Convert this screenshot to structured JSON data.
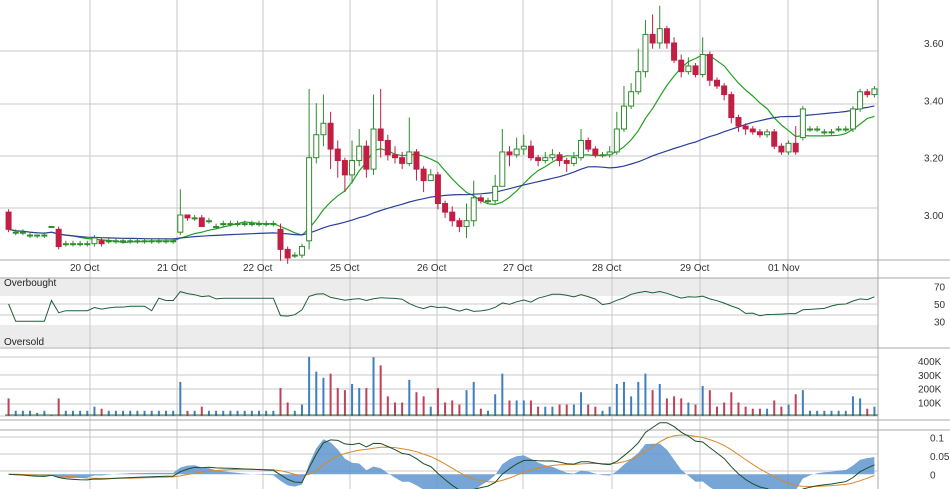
{
  "chart_data": [
    {
      "type": "candlestick",
      "panel": "price",
      "x_labels": [
        "20 Oct",
        "21 Oct",
        "22 Oct",
        "25 Oct",
        "26 Oct",
        "27 Oct",
        "28 Oct",
        "29 Oct",
        "01 Nov"
      ],
      "y_ticks": [
        "3.60",
        "3.40",
        "3.20",
        "3.00"
      ],
      "ylim": [
        2.85,
        3.75
      ],
      "grid": true,
      "overlays": [
        {
          "kind": "short-moving-average",
          "color": "#22a022"
        },
        {
          "kind": "long-moving-average",
          "color": "#2a3f9a"
        }
      ],
      "candles": [
        [
          3.01,
          2.95,
          3.02,
          2.94
        ],
        [
          2.94,
          2.94,
          2.95,
          2.93
        ],
        [
          2.94,
          2.94,
          2.95,
          2.93
        ],
        [
          2.93,
          2.93,
          2.94,
          2.92
        ],
        [
          2.93,
          2.93,
          2.93,
          2.92
        ],
        [
          2.93,
          2.93,
          2.94,
          2.92
        ],
        [
          2.96,
          2.96,
          2.96,
          2.96
        ],
        [
          2.95,
          2.89,
          2.96,
          2.88
        ],
        [
          2.9,
          2.9,
          2.91,
          2.89
        ],
        [
          2.9,
          2.9,
          2.91,
          2.89
        ],
        [
          2.9,
          2.9,
          2.91,
          2.89
        ],
        [
          2.9,
          2.9,
          2.91,
          2.89
        ],
        [
          2.9,
          2.92,
          2.93,
          2.89
        ],
        [
          2.91,
          2.9,
          2.92,
          2.89
        ],
        [
          2.91,
          2.91,
          2.92,
          2.9
        ],
        [
          2.91,
          2.91,
          2.92,
          2.9
        ],
        [
          2.91,
          2.91,
          2.92,
          2.9
        ],
        [
          2.91,
          2.91,
          2.92,
          2.9
        ],
        [
          2.91,
          2.91,
          2.92,
          2.9
        ],
        [
          2.91,
          2.91,
          2.92,
          2.9
        ],
        [
          2.91,
          2.91,
          2.92,
          2.9
        ],
        [
          2.91,
          2.91,
          2.92,
          2.9
        ],
        [
          2.91,
          2.91,
          2.92,
          2.9
        ],
        [
          2.91,
          2.91,
          2.92,
          2.9
        ],
        [
          2.94,
          3.0,
          3.09,
          2.93
        ],
        [
          3.0,
          2.99,
          3.0,
          2.98
        ],
        [
          2.99,
          2.99,
          3.0,
          2.98
        ],
        [
          2.99,
          2.96,
          3.0,
          2.96
        ],
        [
          2.98,
          2.98,
          2.99,
          2.97
        ],
        [
          2.96,
          2.96,
          2.97,
          2.95
        ],
        [
          2.97,
          2.97,
          2.98,
          2.96
        ],
        [
          2.97,
          2.97,
          2.98,
          2.96
        ],
        [
          2.97,
          2.97,
          2.98,
          2.96
        ],
        [
          2.97,
          2.97,
          2.98,
          2.96
        ],
        [
          2.97,
          2.97,
          2.98,
          2.96
        ],
        [
          2.97,
          2.97,
          2.98,
          2.96
        ],
        [
          2.97,
          2.97,
          2.98,
          2.96
        ],
        [
          2.97,
          2.97,
          2.98,
          2.96
        ],
        [
          2.95,
          2.88,
          2.97,
          2.84
        ],
        [
          2.88,
          2.85,
          2.89,
          2.83
        ],
        [
          2.86,
          2.86,
          2.87,
          2.85
        ],
        [
          2.86,
          2.89,
          2.9,
          2.85
        ],
        [
          2.91,
          3.2,
          3.44,
          2.88
        ],
        [
          3.2,
          3.28,
          3.39,
          3.18
        ],
        [
          3.28,
          3.32,
          3.42,
          3.24
        ],
        [
          3.32,
          3.23,
          3.36,
          3.16
        ],
        [
          3.23,
          3.19,
          3.26,
          3.13
        ],
        [
          3.19,
          3.14,
          3.2,
          3.08
        ],
        [
          3.14,
          3.19,
          3.26,
          3.11
        ],
        [
          3.19,
          3.24,
          3.3,
          3.17
        ],
        [
          3.24,
          3.16,
          3.26,
          3.13
        ],
        [
          3.16,
          3.3,
          3.42,
          3.14
        ],
        [
          3.3,
          3.26,
          3.44,
          3.2
        ],
        [
          3.26,
          3.21,
          3.28,
          3.19
        ],
        [
          3.21,
          3.2,
          3.24,
          3.18
        ],
        [
          3.2,
          3.18,
          3.22,
          3.16
        ],
        [
          3.18,
          3.22,
          3.34,
          3.17
        ],
        [
          3.22,
          3.16,
          3.23,
          3.12
        ],
        [
          3.16,
          3.12,
          3.17,
          3.08
        ],
        [
          3.12,
          3.14,
          3.16,
          3.12
        ],
        [
          3.14,
          3.04,
          3.15,
          3.02
        ],
        [
          3.04,
          3.01,
          3.05,
          2.99
        ],
        [
          3.01,
          2.98,
          3.03,
          2.96
        ],
        [
          2.98,
          2.96,
          2.99,
          2.94
        ],
        [
          2.96,
          2.98,
          3.04,
          2.92
        ],
        [
          2.98,
          3.06,
          3.12,
          2.96
        ],
        [
          3.06,
          3.05,
          3.07,
          3.04
        ],
        [
          3.05,
          3.05,
          3.06,
          3.04
        ],
        [
          3.05,
          3.1,
          3.14,
          3.04
        ],
        [
          3.1,
          3.22,
          3.3,
          3.1
        ],
        [
          3.22,
          3.21,
          3.24,
          3.17
        ],
        [
          3.21,
          3.23,
          3.27,
          3.2
        ],
        [
          3.23,
          3.24,
          3.28,
          3.21
        ],
        [
          3.24,
          3.2,
          3.26,
          3.19
        ],
        [
          3.2,
          3.19,
          3.21,
          3.17
        ],
        [
          3.19,
          3.2,
          3.22,
          3.18
        ],
        [
          3.2,
          3.21,
          3.23,
          3.19
        ],
        [
          3.21,
          3.19,
          3.22,
          3.17
        ],
        [
          3.19,
          3.18,
          3.2,
          3.15
        ],
        [
          3.18,
          3.2,
          3.22,
          3.17
        ],
        [
          3.2,
          3.26,
          3.3,
          3.19
        ],
        [
          3.26,
          3.23,
          3.27,
          3.22
        ],
        [
          3.23,
          3.21,
          3.24,
          3.2
        ],
        [
          3.21,
          3.21,
          3.22,
          3.2
        ],
        [
          3.21,
          3.22,
          3.24,
          3.2
        ],
        [
          3.22,
          3.3,
          3.36,
          3.21
        ],
        [
          3.3,
          3.38,
          3.45,
          3.29
        ],
        [
          3.38,
          3.43,
          3.46,
          3.37
        ],
        [
          3.43,
          3.5,
          3.58,
          3.42
        ],
        [
          3.5,
          3.63,
          3.68,
          3.48
        ],
        [
          3.63,
          3.6,
          3.7,
          3.58
        ],
        [
          3.6,
          3.65,
          3.73,
          3.58
        ],
        [
          3.65,
          3.6,
          3.66,
          3.58
        ],
        [
          3.6,
          3.54,
          3.62,
          3.53
        ],
        [
          3.54,
          3.5,
          3.56,
          3.48
        ],
        [
          3.5,
          3.52,
          3.55,
          3.49
        ],
        [
          3.52,
          3.49,
          3.53,
          3.48
        ],
        [
          3.49,
          3.56,
          3.62,
          3.48
        ],
        [
          3.56,
          3.47,
          3.57,
          3.45
        ],
        [
          3.47,
          3.45,
          3.48,
          3.44
        ],
        [
          3.45,
          3.42,
          3.46,
          3.4
        ],
        [
          3.42,
          3.34,
          3.43,
          3.32
        ],
        [
          3.34,
          3.31,
          3.35,
          3.29
        ],
        [
          3.31,
          3.3,
          3.32,
          3.28
        ],
        [
          3.3,
          3.29,
          3.31,
          3.28
        ],
        [
          3.29,
          3.28,
          3.3,
          3.27
        ],
        [
          3.28,
          3.29,
          3.3,
          3.27
        ],
        [
          3.29,
          3.24,
          3.3,
          3.23
        ],
        [
          3.24,
          3.22,
          3.25,
          3.21
        ],
        [
          3.22,
          3.25,
          3.26,
          3.21
        ],
        [
          3.25,
          3.22,
          3.31,
          3.21
        ],
        [
          3.27,
          3.37,
          3.38,
          3.26
        ],
        [
          3.3,
          3.3,
          3.31,
          3.29
        ],
        [
          3.3,
          3.3,
          3.31,
          3.29
        ],
        [
          3.29,
          3.29,
          3.3,
          3.28
        ],
        [
          3.29,
          3.29,
          3.3,
          3.28
        ],
        [
          3.3,
          3.3,
          3.31,
          3.29
        ],
        [
          3.3,
          3.3,
          3.31,
          3.29
        ],
        [
          3.3,
          3.37,
          3.38,
          3.29
        ],
        [
          3.37,
          3.43,
          3.44,
          3.36
        ],
        [
          3.43,
          3.42,
          3.44,
          3.41
        ],
        [
          3.42,
          3.44,
          3.45,
          3.41
        ]
      ]
    },
    {
      "type": "line",
      "panel": "oscillator",
      "band_labels": {
        "upper": "Overbought",
        "lower": "Oversold"
      },
      "y_ticks": [
        "70",
        "50",
        "30"
      ],
      "ylim": [
        20,
        80
      ],
      "color": "#1f5e3a"
    },
    {
      "type": "bar",
      "panel": "volume",
      "y_ticks": [
        "400K",
        "300K",
        "200K",
        "100K"
      ],
      "ylim": [
        0,
        480000
      ],
      "colors": {
        "up": "#3f7fbf",
        "down": "#c0405c",
        "line": "#2b6b3a"
      }
    },
    {
      "type": "area",
      "panel": "macd",
      "y_ticks": [
        "0.1",
        "0.05",
        "0"
      ],
      "ylim": [
        -0.04,
        0.12
      ],
      "colors": {
        "histogram": "#5f95cf",
        "macd": "#1b4f2a",
        "signal": "#d78a2a"
      }
    }
  ],
  "colors": {
    "up_candle": "#2e8b2e",
    "down_candle": "#c21f45",
    "grid": "#c8c8c8",
    "band_fill": "#ececec"
  }
}
